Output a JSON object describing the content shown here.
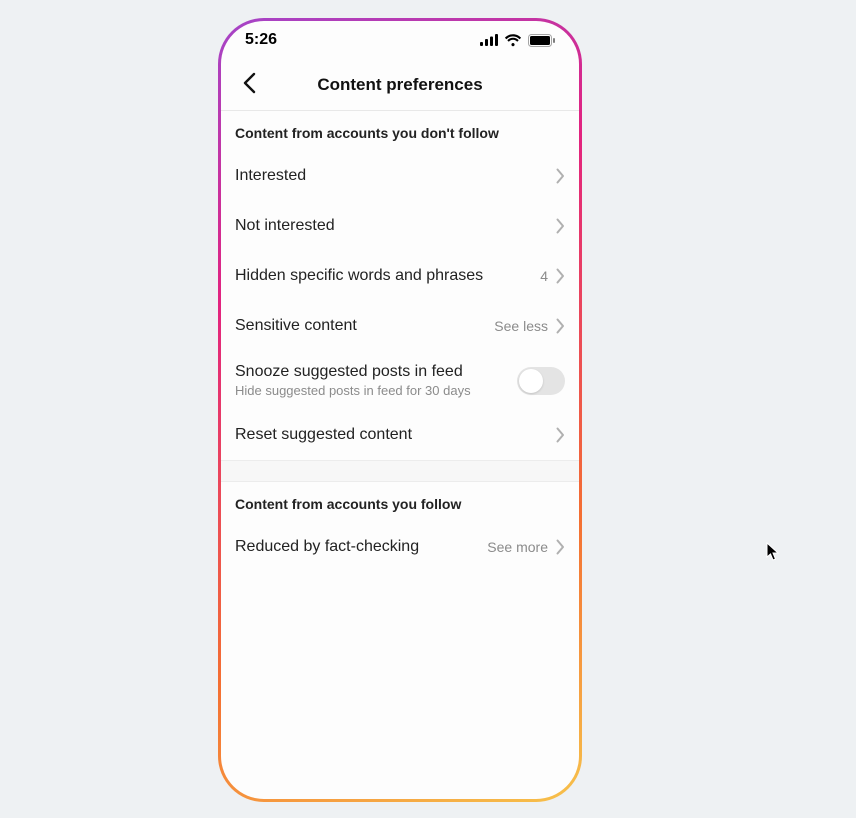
{
  "status": {
    "time": "5:26"
  },
  "nav": {
    "title": "Content preferences"
  },
  "section1": {
    "title": "Content from accounts you don't follow",
    "interested": "Interested",
    "not_interested": "Not interested",
    "hidden_words": "Hidden specific words and phrases",
    "hidden_words_count": "4",
    "sensitive": "Sensitive content",
    "sensitive_val": "See less",
    "snooze": "Snooze suggested posts in feed",
    "snooze_sub": "Hide suggested posts in feed for 30 days",
    "reset": "Reset suggested content"
  },
  "section2": {
    "title": "Content from accounts you follow",
    "fact": "Reduced by fact-checking",
    "fact_val": "See more"
  }
}
